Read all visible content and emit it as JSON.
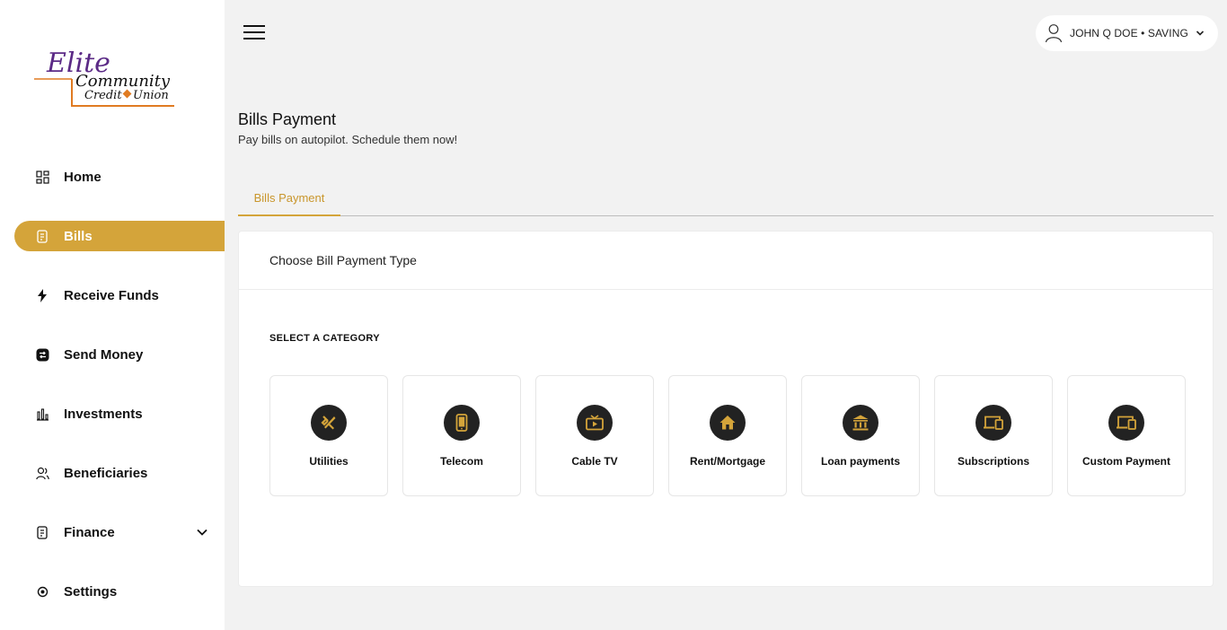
{
  "brand": {
    "logo_text_1": "Elite",
    "logo_text_2": "Community",
    "logo_text_3": "Credit",
    "logo_text_4": "Union",
    "accent": "#d4a43a",
    "logo_purple": "#5b2a86",
    "logo_orange": "#e07b22"
  },
  "sidebar": {
    "items": [
      {
        "label": "Home",
        "icon": "grid-icon"
      },
      {
        "label": "Bills",
        "icon": "receipt-icon",
        "active": true
      },
      {
        "label": "Receive Funds",
        "icon": "bolt-icon"
      },
      {
        "label": "Send Money",
        "icon": "transfer-icon"
      },
      {
        "label": "Investments",
        "icon": "bar-chart-icon"
      },
      {
        "label": "Beneficiaries",
        "icon": "users-icon"
      },
      {
        "label": "Finance",
        "icon": "receipt-icon",
        "has_submenu": true
      },
      {
        "label": "Settings",
        "icon": "gear-icon"
      }
    ]
  },
  "topbar": {
    "user_label": "JOHN Q DOE • SAVING"
  },
  "page": {
    "title": "Bills Payment",
    "subtitle": "Pay bills on autopilot. Schedule them now!"
  },
  "tabs": [
    {
      "label": "Bills Payment",
      "active": true
    }
  ],
  "card": {
    "header": "Choose Bill Payment Type",
    "section_label": "SELECT A CATEGORY",
    "categories": [
      {
        "label": "Utilities",
        "icon": "tools-icon"
      },
      {
        "label": "Telecom",
        "icon": "phone-icon"
      },
      {
        "label": "Cable TV",
        "icon": "tv-icon"
      },
      {
        "label": "Rent/Mortgage",
        "icon": "house-icon"
      },
      {
        "label": "Loan payments",
        "icon": "bank-icon"
      },
      {
        "label": "Subscriptions",
        "icon": "devices-icon"
      },
      {
        "label": "Custom Payment",
        "icon": "devices-icon"
      }
    ]
  }
}
